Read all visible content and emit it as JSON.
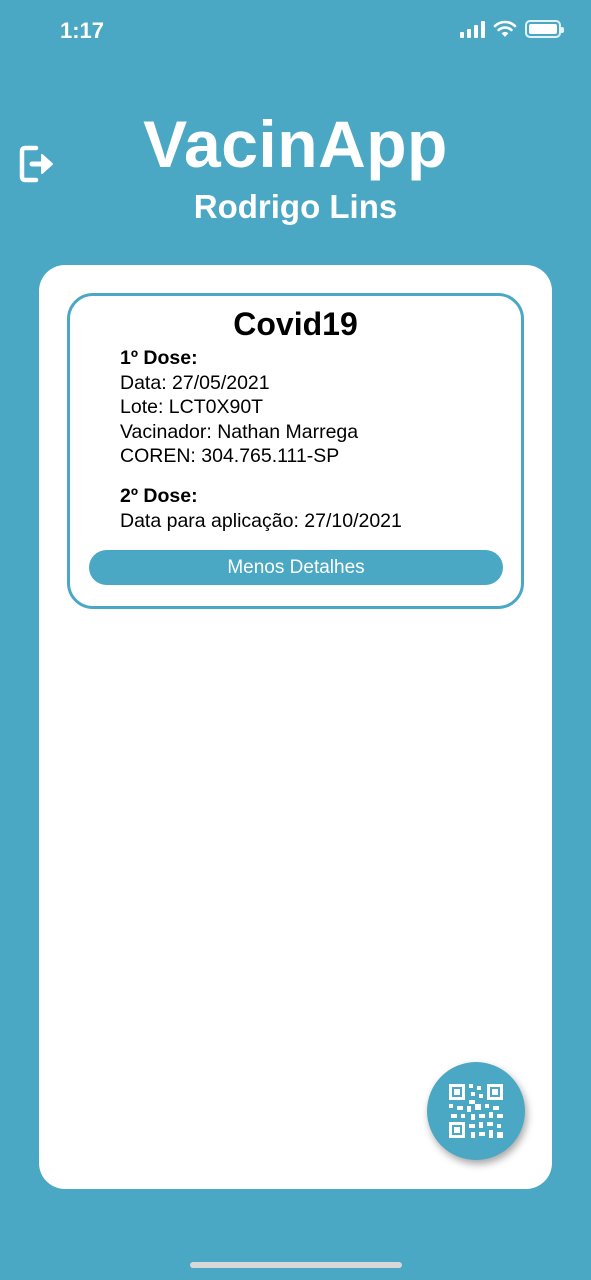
{
  "status_bar": {
    "time": "1:17",
    "icons": [
      "cellular-signal-icon",
      "wifi-icon",
      "battery-icon"
    ]
  },
  "header": {
    "logout_icon": "logout-icon",
    "app_title": "VacinApp",
    "user_name": "Rodrigo Lins"
  },
  "vaccine_card": {
    "title": "Covid19",
    "dose1": {
      "heading": "1º Dose:",
      "date": "Data: 27/05/2021",
      "lot": "Lote: LCT0X90T",
      "vaccinator": "Vacinador: Nathan Marrega",
      "coren": "COREN: 304.765.111-SP"
    },
    "dose2": {
      "heading": "2º Dose:",
      "application_date": "Data para aplicação: 27/10/2021"
    },
    "toggle_button": "Menos Detalhes"
  },
  "fab": {
    "icon": "qr-code-icon"
  },
  "colors": {
    "accent": "#4aa8c4",
    "panel": "#ffffff",
    "text": "#000000"
  }
}
